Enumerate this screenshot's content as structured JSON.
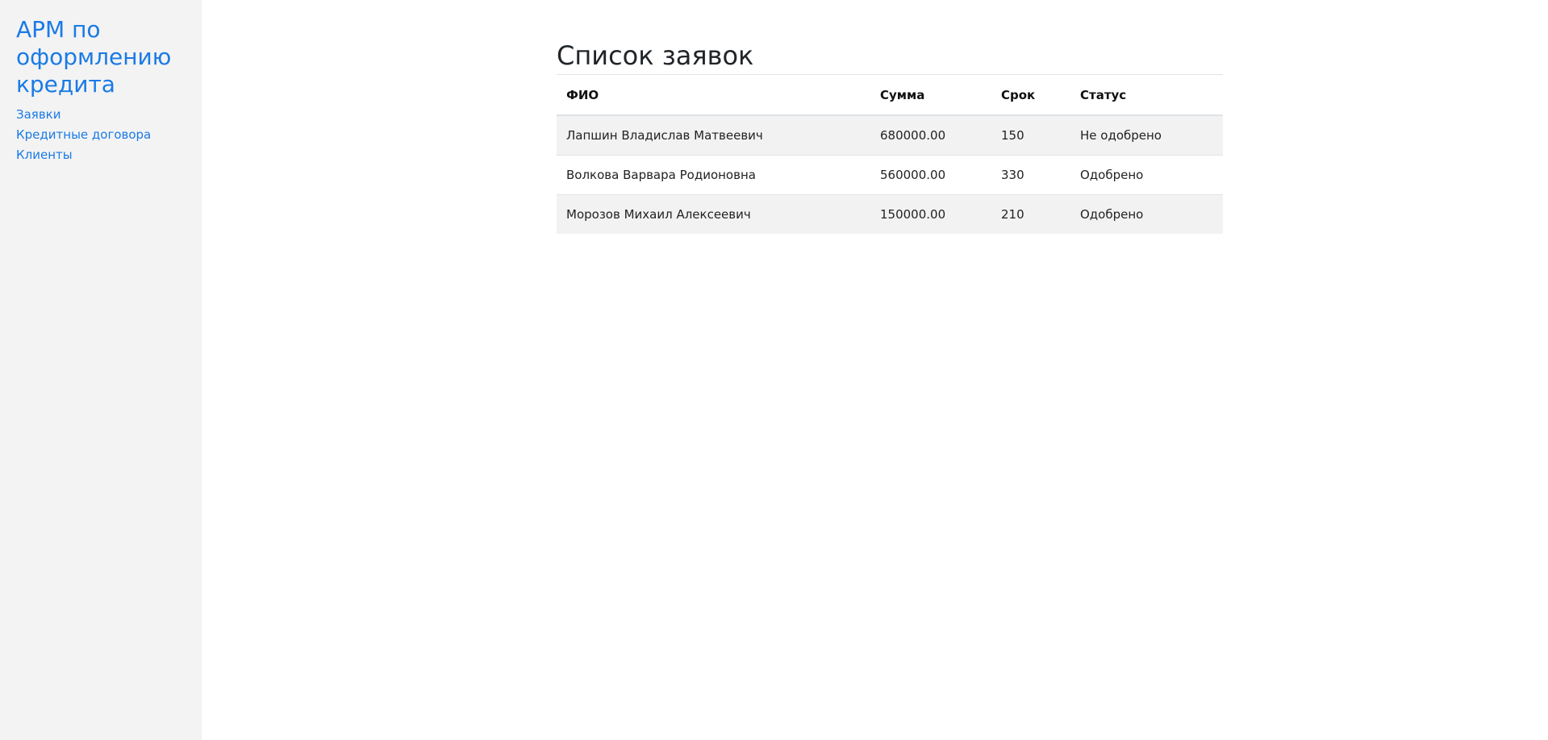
{
  "sidebar": {
    "title": "АРМ по оформлению кредита",
    "nav": [
      {
        "label": "Заявки"
      },
      {
        "label": "Кредитные договора"
      },
      {
        "label": "Клиенты"
      }
    ]
  },
  "main": {
    "title": "Список заявок",
    "table": {
      "headers": {
        "name": "ФИО",
        "sum": "Сумма",
        "term": "Срок",
        "status": "Статус"
      },
      "rows": [
        {
          "name": "Лапшин Владислав Матвеевич",
          "sum": "680000.00",
          "term": "150",
          "status": "Не одобрено"
        },
        {
          "name": "Волкова Варвара Родионовна",
          "sum": "560000.00",
          "term": "330",
          "status": "Одобрено"
        },
        {
          "name": "Морозов Михаил Алексеевич",
          "sum": "150000.00",
          "term": "210",
          "status": "Одобрено"
        }
      ]
    }
  },
  "colors": {
    "accent": "#1a7ae6",
    "sidebar_bg": "#f3f3f3",
    "stripe": "#f2f2f2"
  }
}
